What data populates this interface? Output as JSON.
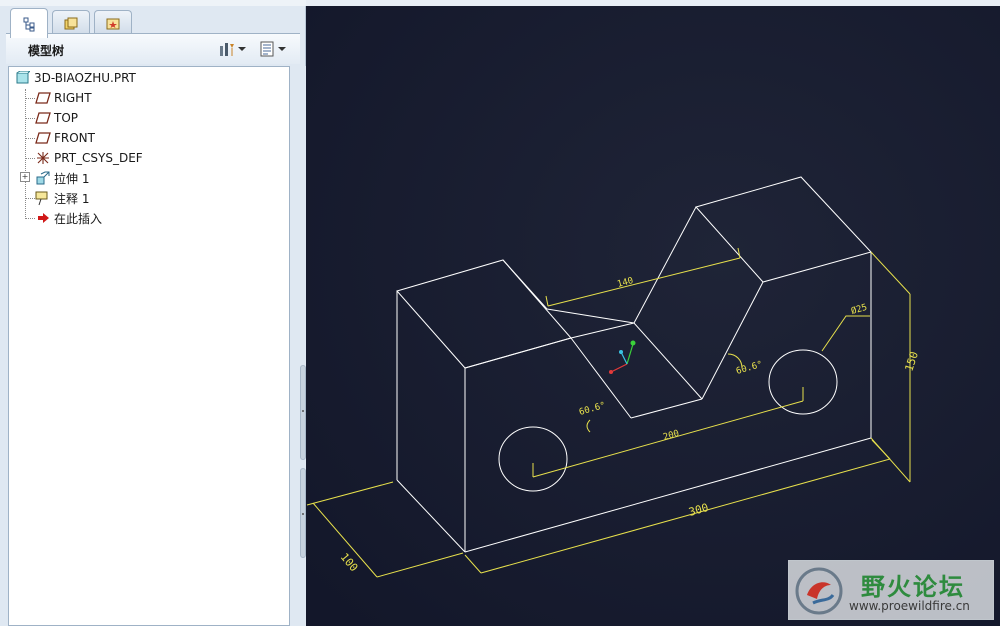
{
  "left_panel": {
    "tabs": [
      {
        "id": "model-tree-tab",
        "icon": "tree-view-icon"
      },
      {
        "id": "folder-browser-tab",
        "icon": "folder-browser-icon"
      },
      {
        "id": "favorites-tab",
        "icon": "favorites-icon"
      }
    ],
    "title": "模型树",
    "settings_icon": "tree-settings-icon",
    "show_icon": "tree-show-icon"
  },
  "tree": {
    "items": [
      {
        "label": "3D-BIAOZHU.PRT",
        "icon": "part-icon"
      },
      {
        "label": "RIGHT",
        "icon": "datum-plane-icon"
      },
      {
        "label": "TOP",
        "icon": "datum-plane-icon"
      },
      {
        "label": "FRONT",
        "icon": "datum-plane-icon"
      },
      {
        "label": "PRT_CSYS_DEF",
        "icon": "coordinate-system-icon"
      },
      {
        "label": "拉伸 1",
        "icon": "extrude-icon"
      },
      {
        "label": "注释 1",
        "icon": "annotation-icon"
      },
      {
        "label": "在此插入",
        "icon": "insert-here-arrow-icon"
      }
    ]
  },
  "viewport": {
    "background": "#171b2b",
    "model_color": "#ffffff",
    "dimension_color": "#e7e04c",
    "dimensions": {
      "top_length": "140",
      "length": "300",
      "depth": "100",
      "height": "150",
      "slot_width": "200",
      "angle_left": "60.6°",
      "angle_right": "60.6°",
      "hole_diameter": "Ø25"
    }
  },
  "watermark": {
    "title": "野火论坛",
    "url": "www.proewildfire.cn"
  }
}
